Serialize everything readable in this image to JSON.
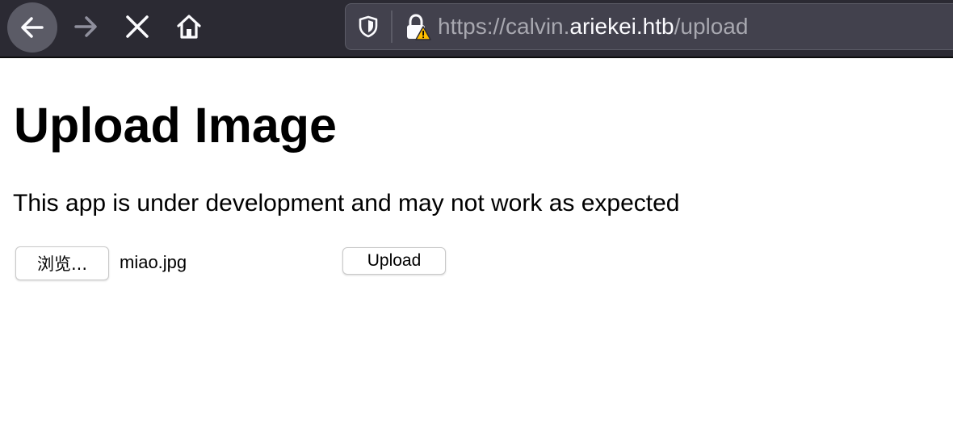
{
  "browser": {
    "url_prefix": "https://calvin.",
    "url_host": "ariekei.htb",
    "url_path": "/upload",
    "icons": [
      "back-arrow-icon",
      "forward-arrow-icon",
      "stop-icon",
      "home-icon",
      "tracking-shield-icon",
      "insecure-lock-icon"
    ]
  },
  "page": {
    "title": "Upload Image",
    "intro": "This app is under development and may not work as expected",
    "browse_label": "浏览...",
    "file_name": "miao.jpg",
    "upload_label": "Upload"
  },
  "colors": {
    "toolbar": "#2b2a33",
    "urlbar": "#42414d",
    "url_dim": "#a8a8b0",
    "url_host": "#fbfbfe",
    "warning": "#ffbf00"
  }
}
